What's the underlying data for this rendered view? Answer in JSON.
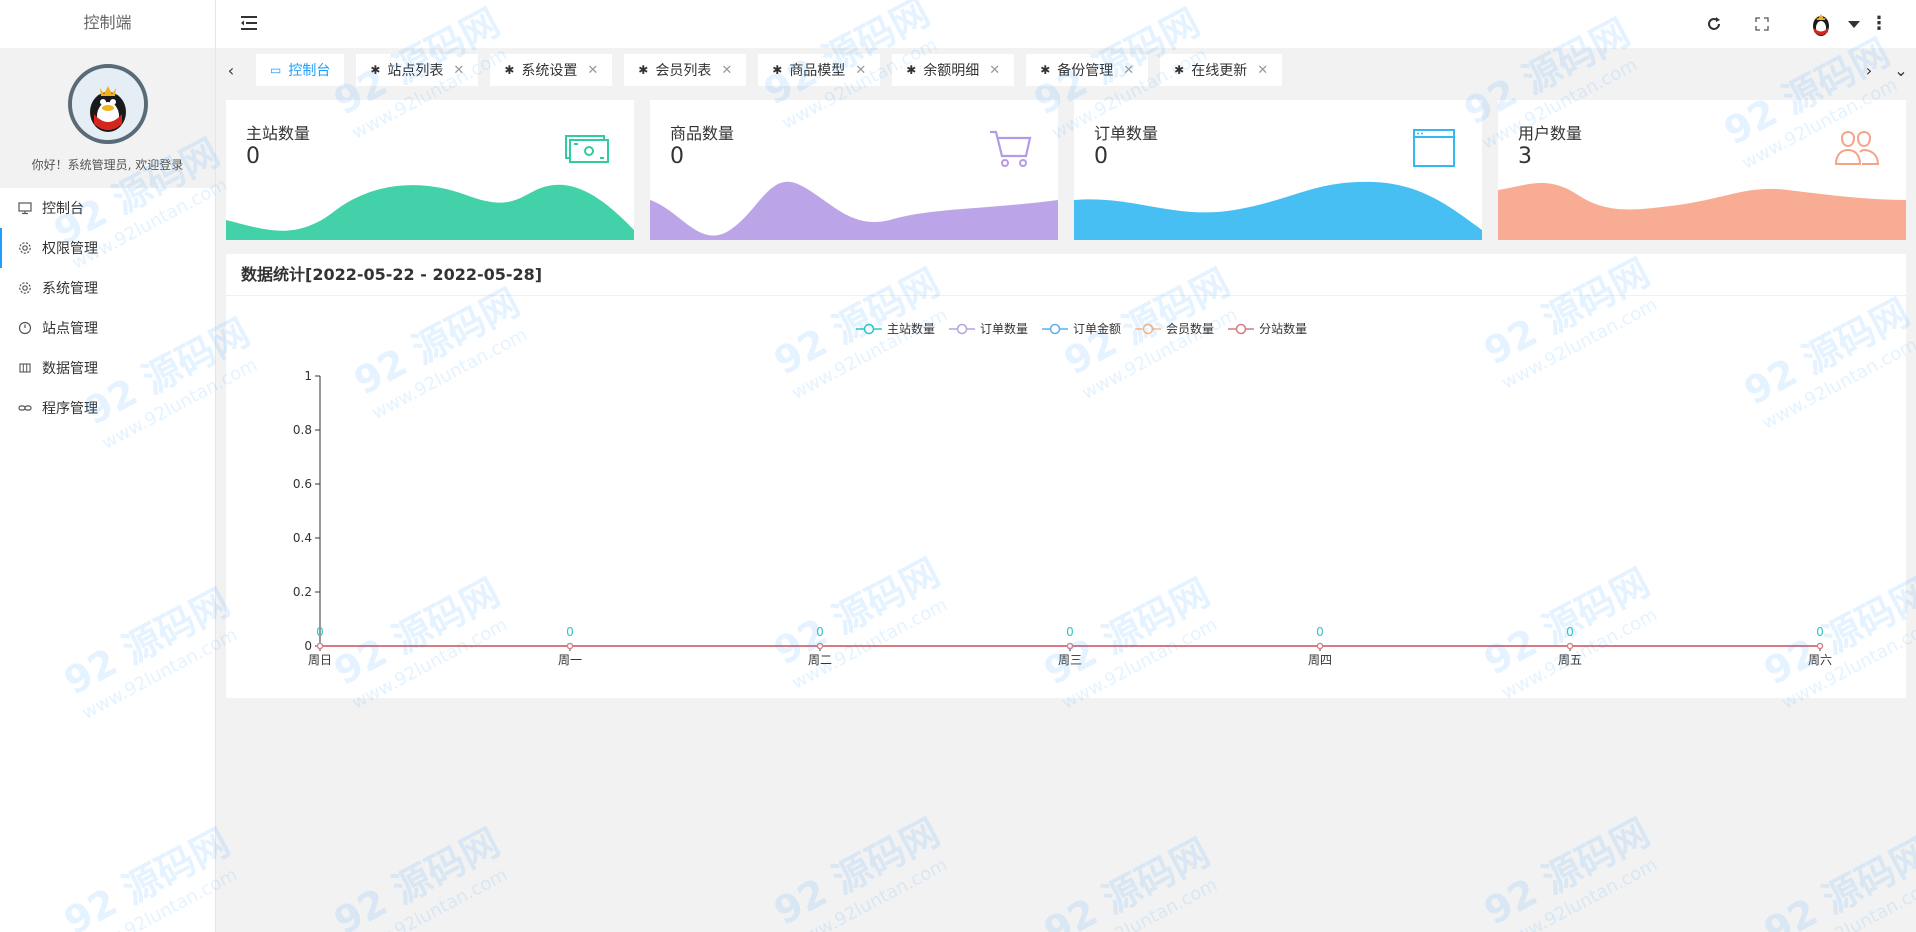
{
  "sidebar": {
    "title": "控制端",
    "welcome": "你好！系统管理员, 欢迎登录",
    "items": [
      {
        "label": "控制台",
        "icon": "monitor-icon"
      },
      {
        "label": "权限管理",
        "icon": "gear-icon",
        "active": true
      },
      {
        "label": "系统管理",
        "icon": "gear-icon"
      },
      {
        "label": "站点管理",
        "icon": "clock-icon"
      },
      {
        "label": "数据管理",
        "icon": "table-icon"
      },
      {
        "label": "程序管理",
        "icon": "link-icon"
      }
    ]
  },
  "header": {
    "icons": [
      "menu-toggle-icon",
      "refresh-icon",
      "fullscreen-icon",
      "user-avatar",
      "caret-down-icon",
      "more-dots-icon"
    ]
  },
  "tabs": [
    {
      "label": "控制台",
      "active": true,
      "closable": false
    },
    {
      "label": "站点列表",
      "closable": true
    },
    {
      "label": "系统设置",
      "closable": true
    },
    {
      "label": "会员列表",
      "closable": true
    },
    {
      "label": "商品模型",
      "closable": true
    },
    {
      "label": "余额明细",
      "closable": true
    },
    {
      "label": "备份管理",
      "closable": true
    },
    {
      "label": "在线更新",
      "closable": true
    }
  ],
  "cards": [
    {
      "title": "主站数量",
      "value": "0",
      "color": "#2ecc9f",
      "icon": "money-icon"
    },
    {
      "title": "商品数量",
      "value": "0",
      "color": "#b49be6",
      "icon": "cart-icon"
    },
    {
      "title": "订单数量",
      "value": "0",
      "color": "#33b8f2",
      "icon": "window-icon"
    },
    {
      "title": "用户数量",
      "value": "3",
      "color": "#f7a388",
      "icon": "users-icon"
    }
  ],
  "panel": {
    "title": "数据统计[2022-05-22 - 2022-05-28]"
  },
  "chart_data": {
    "type": "line",
    "categories": [
      "周日",
      "周一",
      "周二",
      "周三",
      "周四",
      "周五",
      "周六"
    ],
    "series": [
      {
        "name": "主站数量",
        "values": [
          0,
          0,
          0,
          0,
          0,
          0,
          0
        ],
        "color": "#2ec7c9"
      },
      {
        "name": "订单数量",
        "values": [
          0,
          0,
          0,
          0,
          0,
          0,
          0
        ],
        "color": "#b6a2de"
      },
      {
        "name": "订单金额",
        "values": [
          0,
          0,
          0,
          0,
          0,
          0,
          0
        ],
        "color": "#5ab1ef"
      },
      {
        "name": "会员数量",
        "values": [
          0,
          0,
          0,
          0,
          0,
          0,
          0
        ],
        "color": "#ffb980"
      },
      {
        "name": "分站数量",
        "values": [
          0,
          0,
          0,
          0,
          0,
          0,
          0
        ],
        "color": "#d87a80"
      }
    ],
    "yticks": [
      "0",
      "0.2",
      "0.4",
      "0.6",
      "0.8",
      "1"
    ],
    "ylim": [
      0,
      1
    ],
    "data_labels": [
      "0",
      "0",
      "0",
      "0",
      "0",
      "0",
      "0"
    ],
    "legend": "top-center",
    "grid": false
  },
  "watermark": {
    "big": "92 源码网",
    "small": "www.92luntan.com"
  }
}
